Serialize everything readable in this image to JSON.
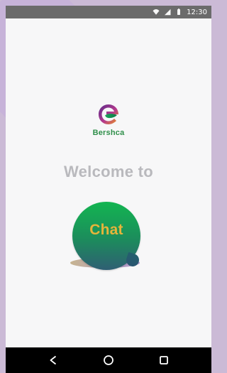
{
  "status_bar": {
    "time": "12:30"
  },
  "brand": {
    "name": "Bershca"
  },
  "welcome": {
    "text": "Welcome to"
  },
  "chat": {
    "label": "Chat"
  },
  "nav": {
    "back_icon": "back-icon",
    "home_icon": "home-icon",
    "recents_icon": "recents-icon"
  }
}
